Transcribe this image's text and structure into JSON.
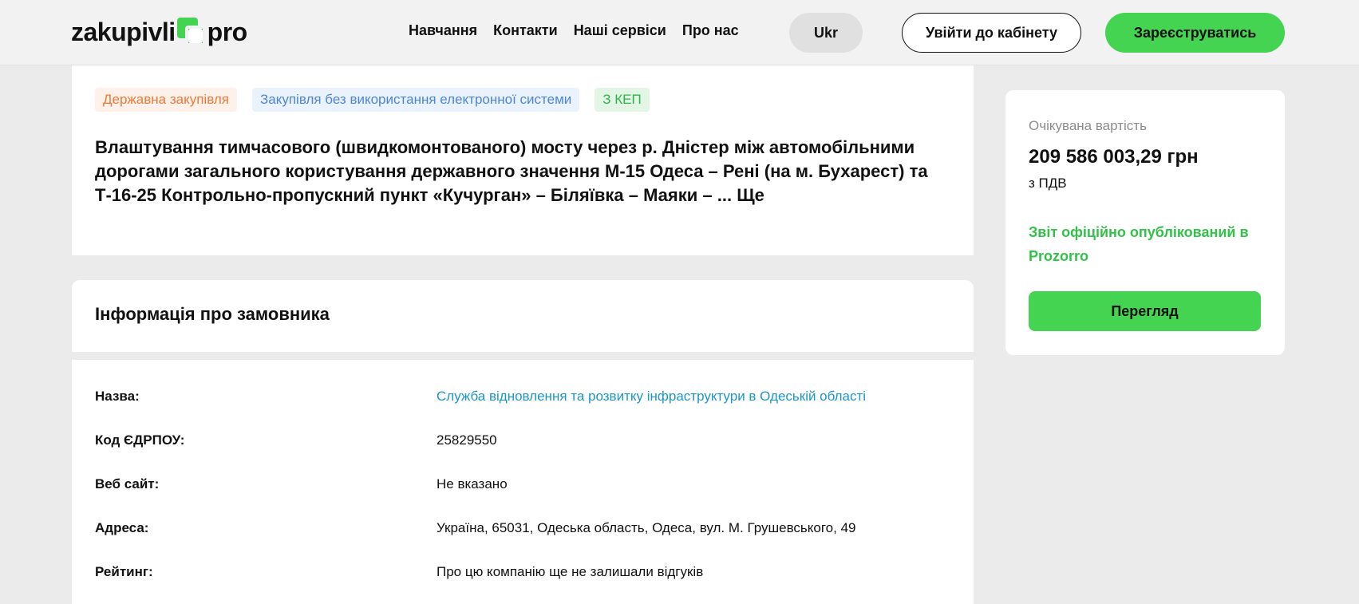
{
  "header": {
    "logo_left": "zakupivli",
    "logo_right": "pro",
    "nav": [
      "Навчання",
      "Контакти",
      "Наші сервіси",
      "Про нас"
    ],
    "lang": "Ukr",
    "login_label": "Увійти до кабінету",
    "register_label": "Зареєструватись"
  },
  "tender": {
    "tags": [
      "Державна закупівля",
      "Закупівля без використання електронної системи",
      "З КЕП"
    ],
    "title": "Влаштування тимчасового (швидкомонтованого) мосту через р. Дністер між автомобільними дорогами загального користування державного значення М-15 Одеса – Рені (на м. Бухарест) та Т-16-25 Контрольно-пропускний пункт «Кучурган» – Біляївка – Маяки – ...",
    "more_label": "Ще"
  },
  "customer": {
    "section_title": "Інформація про замовника",
    "rows": [
      {
        "label": "Назва:",
        "value": "Служба відновлення та розвитку інфраструктури в Одеській області"
      },
      {
        "label": "Код ЄДРПОУ:",
        "value": "25829550"
      },
      {
        "label": "Веб сайт:",
        "value": "Не вказано"
      },
      {
        "label": "Адреса:",
        "value": "Україна, 65031, Одеська область, Одеса, вул. М. Грушевського, 49"
      },
      {
        "label": "Рейтинг:",
        "value": "Про цю компанію ще не залишали відгуків"
      }
    ]
  },
  "sidebar": {
    "expected_label": "Очікувана вартість",
    "expected_value": "209 586 003,29 грн",
    "vat": "з ПДВ",
    "report_text": "Звіт офіційно опублікований в Prozorro",
    "view_label": "Перегляд"
  },
  "colors": {
    "accent_green": "#45d452",
    "link_blue": "#1c96c8",
    "tag_orange": "#ef7a3b",
    "tag_blue": "#4d86d9",
    "tag_green": "#2fb34a"
  }
}
